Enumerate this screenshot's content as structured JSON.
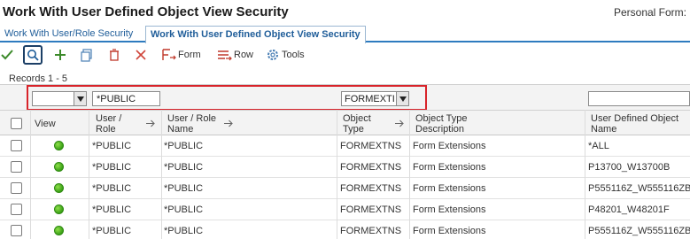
{
  "window": {
    "title": "Work With User Defined Object View Security",
    "personal_form": "Personal Form:"
  },
  "tabs": [
    {
      "label": "Work With User/Role Security"
    },
    {
      "label": "Work With User Defined Object View Security"
    }
  ],
  "toolbar": {
    "form_label": "Form",
    "row_label": "Row",
    "tools_label": "Tools"
  },
  "records": "Records 1 - 5",
  "qbe": {
    "type_value": "",
    "user_role_value": "*PUBLIC",
    "object_type_value": "FORMEXTI",
    "udo_name_value": ""
  },
  "columns": {
    "view": "View",
    "user_role_1": "User /",
    "user_role_2": "Role",
    "name_1": "User / Role",
    "name_2": "Name",
    "obj_type_1": "Object",
    "obj_type_2": "Type",
    "otd_1": "Object Type",
    "otd_2": "Description",
    "udo_1": "User Defined Object",
    "udo_2": "Name"
  },
  "rows": [
    {
      "user_role": "*PUBLIC",
      "name": "*PUBLIC",
      "object_type": "FORMEXTNS",
      "description": "Form Extensions",
      "udo_name": "*ALL"
    },
    {
      "user_role": "*PUBLIC",
      "name": "*PUBLIC",
      "object_type": "FORMEXTNS",
      "description": "Form Extensions",
      "udo_name": "P13700_W13700B"
    },
    {
      "user_role": "*PUBLIC",
      "name": "*PUBLIC",
      "object_type": "FORMEXTNS",
      "description": "Form Extensions",
      "udo_name": "P555116Z_W555116ZB"
    },
    {
      "user_role": "*PUBLIC",
      "name": "*PUBLIC",
      "object_type": "FORMEXTNS",
      "description": "Form Extensions",
      "udo_name": "P48201_W48201F"
    },
    {
      "user_role": "*PUBLIC",
      "name": "*PUBLIC",
      "object_type": "FORMEXTNS",
      "description": "Form Extensions",
      "udo_name": "P555116Z_W555116ZB"
    }
  ],
  "colors": {
    "accent": "#2e7bbf",
    "highlight": "#d8232a",
    "status_green": "#3aa016"
  },
  "icons": [
    "ok-check-icon",
    "find-icon",
    "add-icon",
    "copy-icon",
    "delete-icon",
    "close-icon",
    "form-exit-icon",
    "row-exit-icon",
    "tools-gear-icon",
    "status-dot-icon",
    "sort-icon",
    "chevron-down-icon"
  ]
}
